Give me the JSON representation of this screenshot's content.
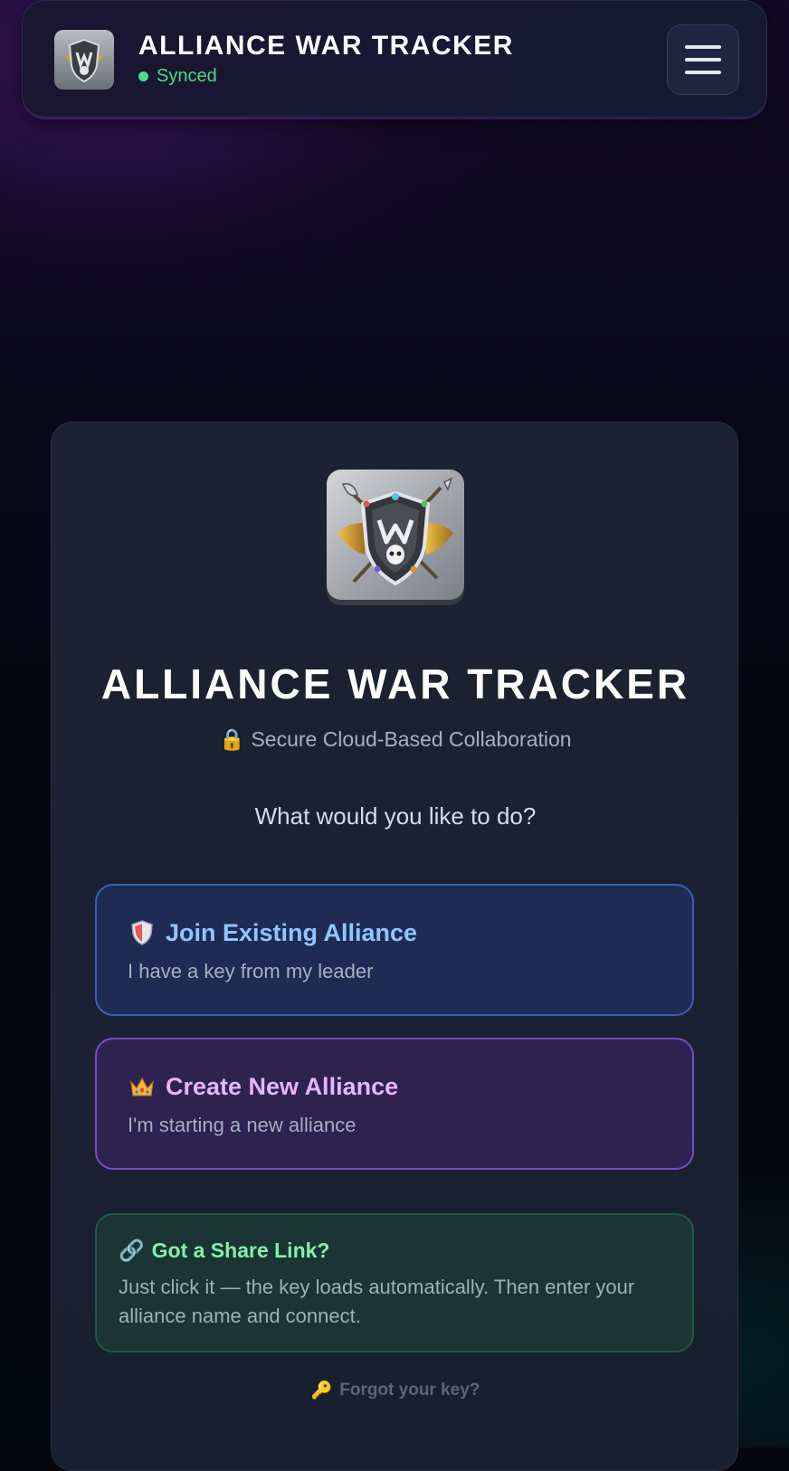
{
  "header": {
    "title": "ALLIANCE WAR TRACKER",
    "status": "Synced",
    "status_color": "#4ade80",
    "logo_icon": "shield-crest-icon",
    "menu_icon": "hamburger-menu-icon"
  },
  "card": {
    "title": "ALLIANCE WAR TRACKER",
    "subtitle_icon": "lock-icon",
    "subtitle": "Secure Cloud-Based Collaboration",
    "question": "What would you like to do?"
  },
  "options": {
    "join": {
      "icon": "shield-icon",
      "title": "Join Existing Alliance",
      "description": "I have a key from my leader",
      "accent": "#93c5fd"
    },
    "create": {
      "icon": "crown-icon",
      "title": "Create New Alliance",
      "description": "I'm starting a new alliance",
      "accent": "#e9b3ff"
    }
  },
  "share": {
    "icon": "link-icon",
    "title": "Got a Share Link?",
    "description": "Just click it — the key loads automatically. Then enter your alliance name and connect.",
    "accent": "#86efac"
  },
  "forgot": {
    "icon": "key-icon",
    "label": "Forgot your key?"
  }
}
